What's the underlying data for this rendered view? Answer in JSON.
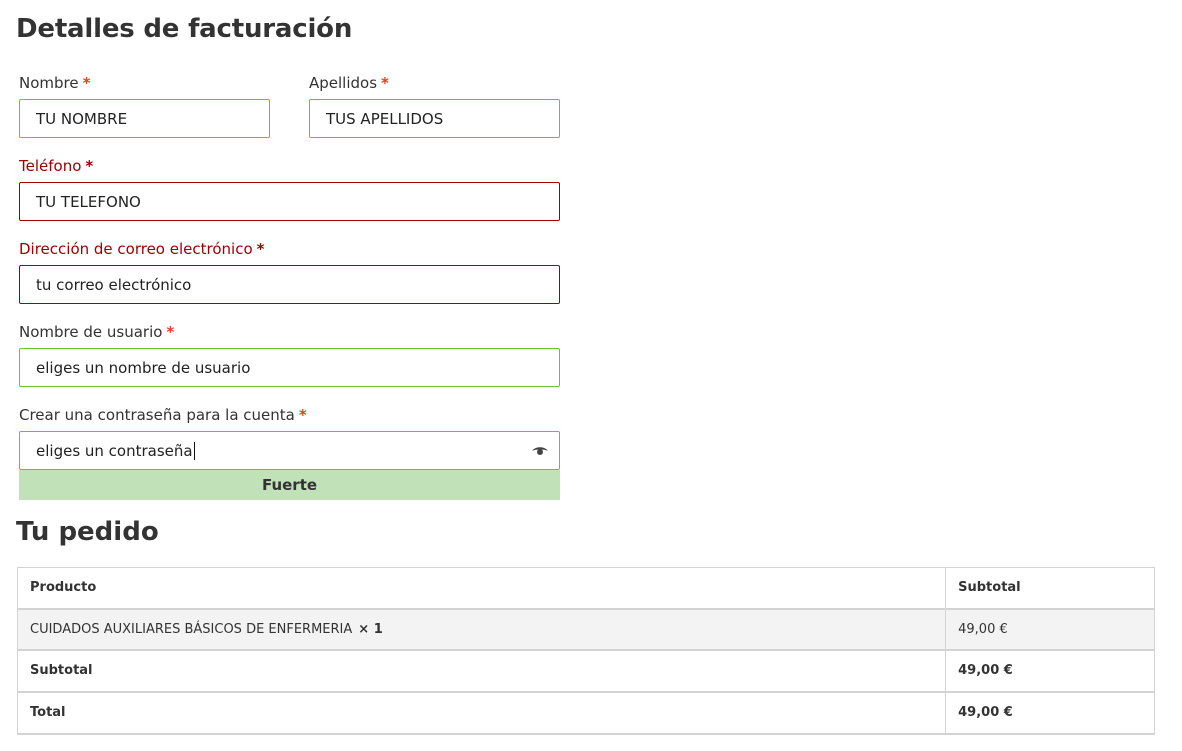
{
  "billing": {
    "title": "Detalles de facturación",
    "required_mark": "*",
    "first_name": {
      "label": "Nombre",
      "value": "TU NOMBRE"
    },
    "last_name": {
      "label": "Apellidos",
      "value": "TUS APELLIDOS"
    },
    "phone": {
      "label": "Teléfono",
      "value": "TU TELEFONO"
    },
    "email": {
      "label": "Dirección de correo electrónico",
      "value": "tu correo electrónico"
    },
    "username": {
      "label": "Nombre de usuario",
      "value": "eliges un nombre de usuario"
    },
    "password": {
      "label": "Crear una contraseña para la cuenta",
      "value": "eliges un contraseña",
      "icon": "eye-icon"
    },
    "password_strength": "Fuerte"
  },
  "order": {
    "title": "Tu pedido",
    "headers": {
      "product": "Producto",
      "subtotal": "Subtotal"
    },
    "items": [
      {
        "name": "CUIDADOS AUXILIARES BÁSICOS DE ENFERMERIA",
        "quantity": "× 1",
        "subtotal": "49,00 €"
      }
    ],
    "subtotal_row": {
      "label": "Subtotal",
      "value": "49,00 €"
    },
    "total_row": {
      "label": "Total",
      "value": "49,00 €"
    }
  },
  "colors": {
    "valid_border": "#6dc22e",
    "invalid_border": "#a00000",
    "required_mark": "#e2401c",
    "strength_strong": "#c1e1b9"
  }
}
